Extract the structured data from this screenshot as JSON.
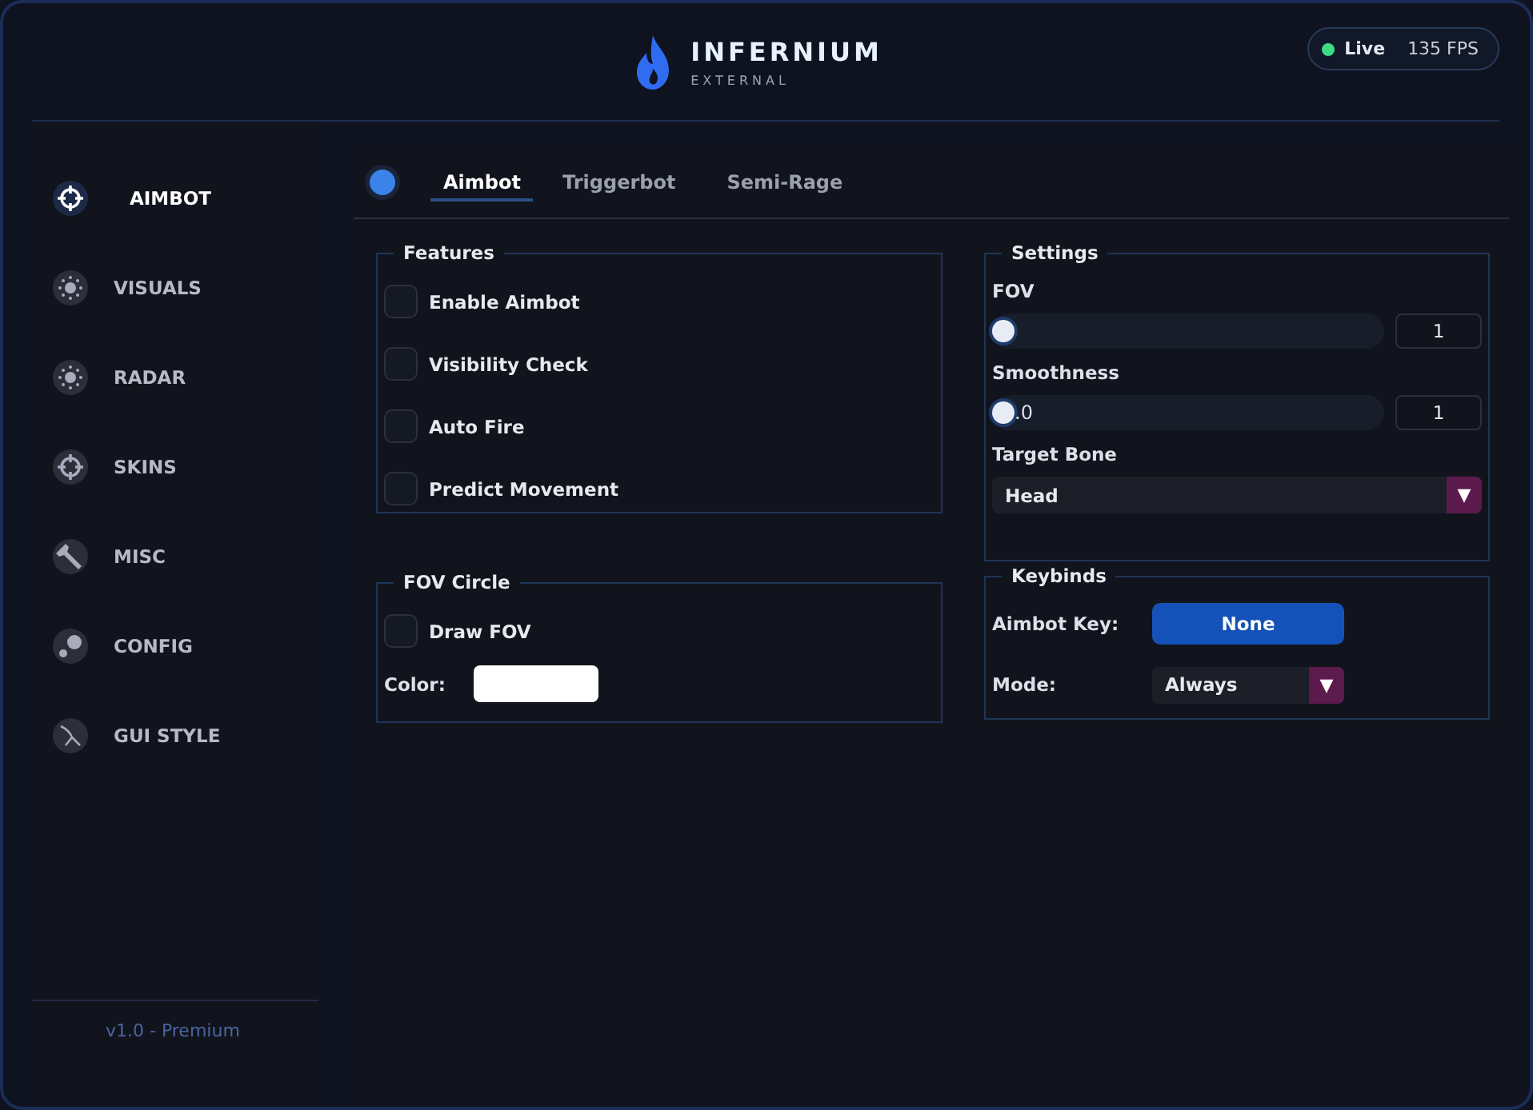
{
  "header": {
    "brand": "INFERNIUM",
    "subtitle": "EXTERNAL",
    "status": {
      "live": true,
      "label": "Live",
      "fps": "135 FPS"
    }
  },
  "sidebar": {
    "items": [
      {
        "label": "AIMBOT",
        "selected": true
      },
      {
        "label": "VISUALS",
        "selected": false
      },
      {
        "label": "RADAR",
        "selected": false
      },
      {
        "label": "SKINS",
        "selected": false
      },
      {
        "label": "MISC",
        "selected": false
      },
      {
        "label": "CONFIG",
        "selected": false
      },
      {
        "label": "GUI STYLE",
        "selected": false
      }
    ],
    "footer": "v1.0 - Premium"
  },
  "tabs": [
    {
      "label": "Aimbot",
      "selected": true
    },
    {
      "label": "Triggerbot",
      "selected": false
    },
    {
      "label": "Semi-Rage",
      "selected": false
    }
  ],
  "features": {
    "title": "Features",
    "options": [
      {
        "label": "Enable Aimbot",
        "checked": false
      },
      {
        "label": "Visibility Check",
        "checked": false
      },
      {
        "label": "Auto Fire",
        "checked": false
      },
      {
        "label": "Predict Movement",
        "checked": false
      }
    ]
  },
  "fov_circle": {
    "title": "FOV Circle",
    "options": [
      {
        "label": "Draw FOV",
        "checked": false
      }
    ],
    "color_label": "Color:",
    "color": "#ffffff"
  },
  "settings": {
    "title": "Settings",
    "sliders": [
      {
        "label": "FOV",
        "level": 0,
        "value": "1"
      },
      {
        "label": "Smoothness",
        "level": 0,
        "track_text": ".0",
        "value": "1"
      }
    ],
    "target_bone": {
      "label": "Target Bone",
      "value": "Head",
      "arrow": "▼"
    }
  },
  "keybinds": {
    "title": "Keybinds",
    "key_label": "Aimbot Key:",
    "key_value": "None",
    "mode_label": "Mode:",
    "mode_value": "Always",
    "arrow": "▼"
  }
}
